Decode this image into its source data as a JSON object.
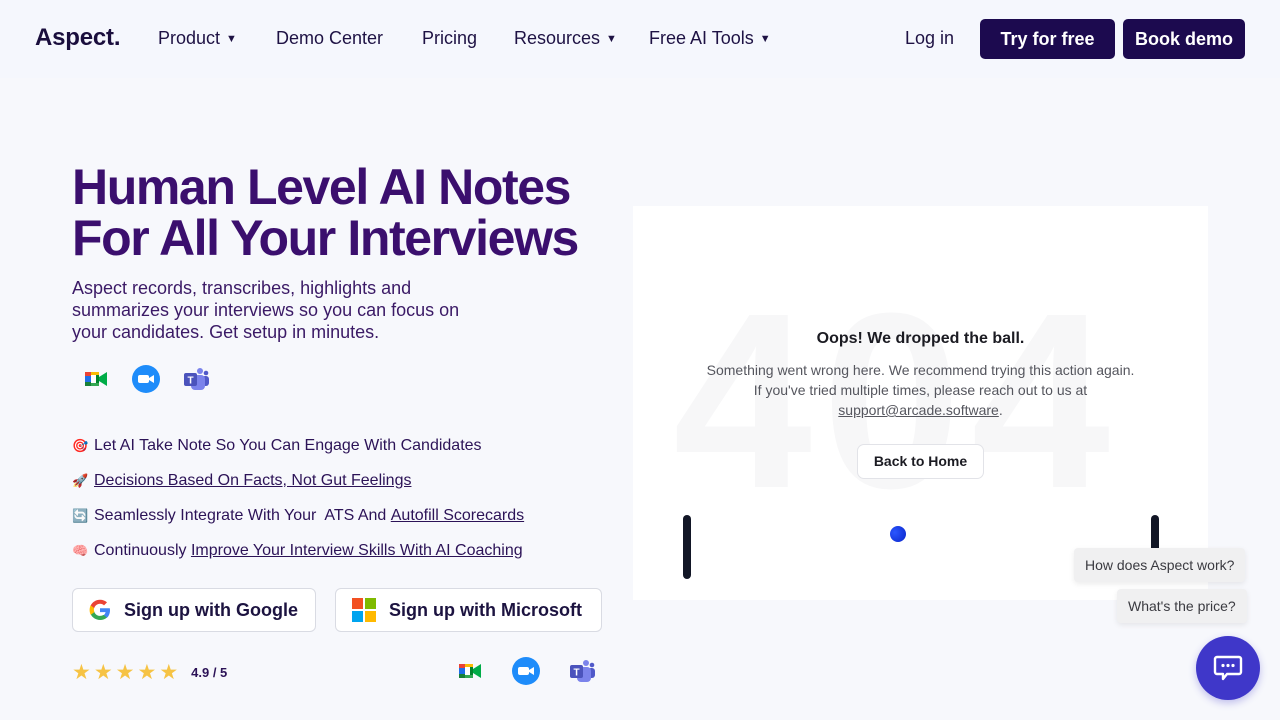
{
  "nav": {
    "logo": "Aspect.",
    "items": [
      {
        "label": "Product",
        "has_dropdown": true
      },
      {
        "label": "Demo Center",
        "has_dropdown": false
      },
      {
        "label": "Pricing",
        "has_dropdown": false
      },
      {
        "label": "Resources",
        "has_dropdown": true
      },
      {
        "label": "Free AI Tools",
        "has_dropdown": true
      }
    ],
    "caret": "▼",
    "login": "Log in",
    "try_free": "Try for free",
    "book_demo": "Book demo"
  },
  "hero": {
    "title_line1": "Human Level AI Notes",
    "title_line2": "For All Your Interviews",
    "subtitle": "Aspect records, transcribes, highlights and summarizes your interviews so you can focus on your candidates. Get setup in minutes.",
    "integrations": [
      "google-meet-icon",
      "zoom-icon",
      "microsoft-teams-icon"
    ],
    "features": [
      {
        "emoji": "🎯",
        "plain": "Let AI Take Note So You Can Engage With Candidates",
        "link": ""
      },
      {
        "emoji": "🚀",
        "plain": "",
        "link": "Decisions Based On Facts, Not Gut Feelings"
      },
      {
        "emoji": "🔄",
        "plain": "Seamlessly Integrate With Your  ATS And ",
        "link": "Autofill Scorecards"
      },
      {
        "emoji": "🧠",
        "plain": "Continuously ",
        "link": "Improve Your Interview Skills With AI Coaching"
      }
    ],
    "signup_google": "Sign up with Google",
    "signup_microsoft": "Sign up with Microsoft",
    "rating": {
      "stars": 5,
      "value": "4.9 / 5"
    }
  },
  "error_card": {
    "background_text": "404",
    "title": "Oops! We dropped the ball.",
    "message_line1": "Something went wrong here. We recommend trying this action again.",
    "message_line2": "If you've tried multiple times, please reach out to us at",
    "email": "support@arcade.software",
    "email_suffix": ".",
    "back_button": "Back to Home"
  },
  "chat": {
    "suggestions": [
      "How does Aspect work?",
      "What's the price?"
    ],
    "accent": "#3f37c9"
  },
  "colors": {
    "brand_dark": "#1c0a4f",
    "heading": "#3b0f6e",
    "star": "#f6c344"
  }
}
